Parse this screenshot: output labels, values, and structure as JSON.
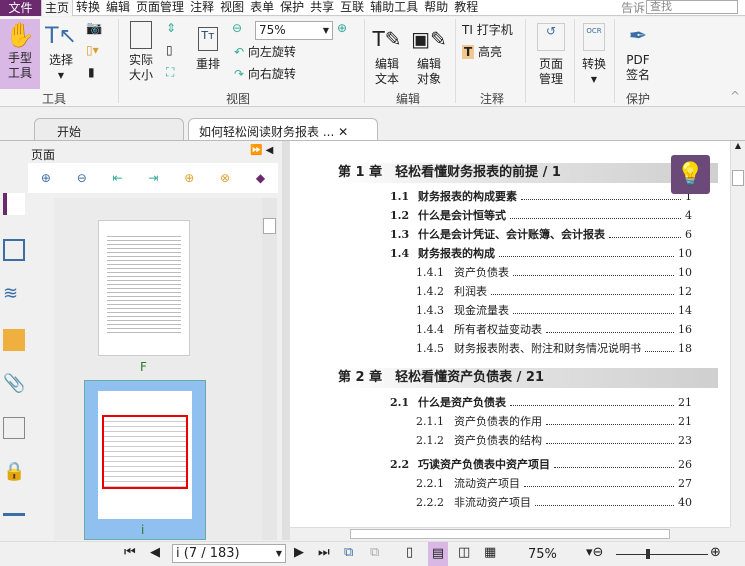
{
  "menu": {
    "file": "文件",
    "items": [
      "主页",
      "转换",
      "编辑",
      "页面管理",
      "注释",
      "视图",
      "表单",
      "保护",
      "共享",
      "互联",
      "辅助工具",
      "帮助",
      "教程"
    ],
    "tell": "告诉",
    "search_placeholder": "查找"
  },
  "ribbon": {
    "hand": "手型\n工具",
    "select": "选择",
    "tools_group": "工具",
    "actual": "实际\n大小",
    "reflow": "重排",
    "zoom": "75%",
    "rotate_left": "向左旋转",
    "rotate_right": "向右旋转",
    "view_group": "视图",
    "edit_text": "编辑\n文本",
    "edit_object": "编辑\n对象",
    "edit_group": "编辑",
    "typewriter": "打字机",
    "highlight": "高亮",
    "comment_group": "注释",
    "page_manage": "页面\n管理",
    "convert": "转换",
    "pdf_sign": "PDF\n签名",
    "protect_group": "保护"
  },
  "tabs": [
    {
      "label": "开始"
    },
    {
      "label": "如何轻松阅读财务报表 ..."
    }
  ],
  "panel": {
    "title": "页面",
    "thumbs": [
      {
        "label": "F"
      },
      {
        "label": "i"
      }
    ]
  },
  "toc": {
    "ch1": "第 1 章　轻松看懂财务报表的前提 / 1",
    "ch2": "第 2 章　轻松看懂资产负债表 / 21",
    "entries1": [
      {
        "num": "1.1",
        "title": "财务报表的构成要素",
        "page": "1",
        "level": 1
      },
      {
        "num": "1.2",
        "title": "什么是会计恒等式",
        "page": "4",
        "level": 1
      },
      {
        "num": "1.3",
        "title": "什么是会计凭证、会计账簿、会计报表",
        "page": "6",
        "level": 1
      },
      {
        "num": "1.4",
        "title": "财务报表的构成",
        "page": "10",
        "level": 1
      },
      {
        "num": "1.4.1",
        "title": "资产负债表",
        "page": "10",
        "level": 2
      },
      {
        "num": "1.4.2",
        "title": "利润表",
        "page": "12",
        "level": 2
      },
      {
        "num": "1.4.3",
        "title": "现金流量表",
        "page": "14",
        "level": 2
      },
      {
        "num": "1.4.4",
        "title": "所有者权益变动表",
        "page": "16",
        "level": 2
      },
      {
        "num": "1.4.5",
        "title": "财务报表附表、附注和财务情况说明书",
        "page": "18",
        "level": 2
      }
    ],
    "entries2": [
      {
        "num": "2.1",
        "title": "什么是资产负债表",
        "page": "21",
        "level": 1
      },
      {
        "num": "2.1.1",
        "title": "资产负债表的作用",
        "page": "21",
        "level": 2
      },
      {
        "num": "2.1.2",
        "title": "资产负债表的结构",
        "page": "23",
        "level": 2
      },
      {
        "num": "2.2",
        "title": "巧读资产负债表中资产项目",
        "page": "26",
        "level": 1
      },
      {
        "num": "2.2.1",
        "title": "流动资产项目",
        "page": "27",
        "level": 2
      },
      {
        "num": "2.2.2",
        "title": "非流动资产项目",
        "page": "40",
        "level": 2
      }
    ]
  },
  "status": {
    "page": "i (7 / 183)",
    "zoom": "75%"
  },
  "colors": {
    "brand": "#6b2a6e",
    "active": "#d9b8e6"
  }
}
